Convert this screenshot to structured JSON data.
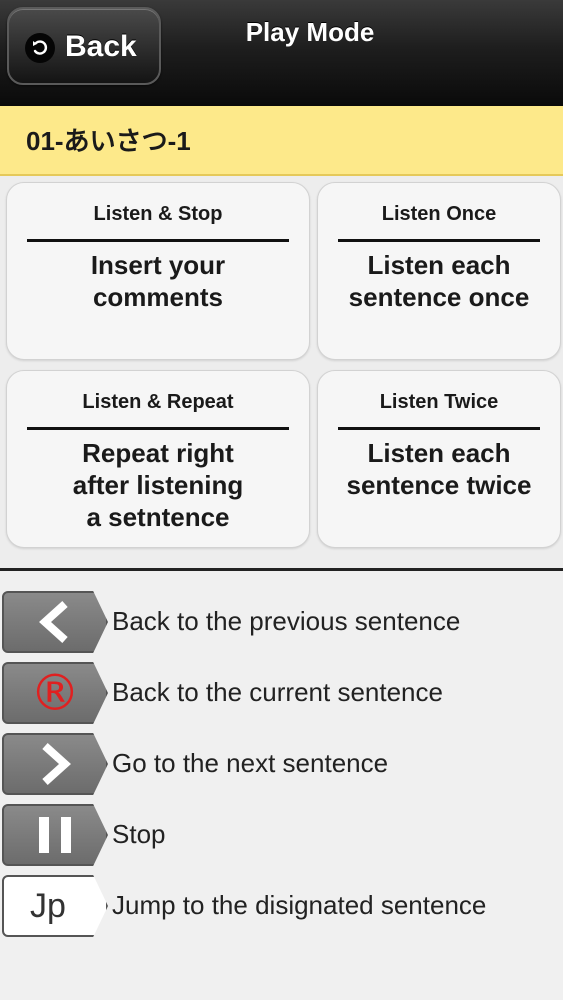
{
  "header": {
    "back_label": "Back",
    "title": "Play Mode"
  },
  "lesson": {
    "title": "01-あいさつ-1",
    "bar_color": "#fde98a"
  },
  "modes": [
    {
      "name": "Listen & Stop",
      "description": "Insert your comments"
    },
    {
      "name": "Listen Once",
      "description": "Listen each sentence once"
    },
    {
      "name": "Listen & Repeat",
      "description": "Repeat right after listening a setntence"
    },
    {
      "name": "Listen Twice",
      "description": "Listen each sentence twice"
    }
  ],
  "legend": [
    {
      "icon": "chevron-left-icon",
      "label": "Back to the previous sentence"
    },
    {
      "icon": "registered-r-icon",
      "label": "Back to the current sentence",
      "icon_text": "®",
      "icon_color": "#e02020"
    },
    {
      "icon": "chevron-right-icon",
      "label": "Go to the next sentence"
    },
    {
      "icon": "pause-icon",
      "label": "Stop"
    },
    {
      "icon": "jp-icon",
      "label": "Jump to the disignated sentence",
      "icon_text": "Jp"
    }
  ]
}
